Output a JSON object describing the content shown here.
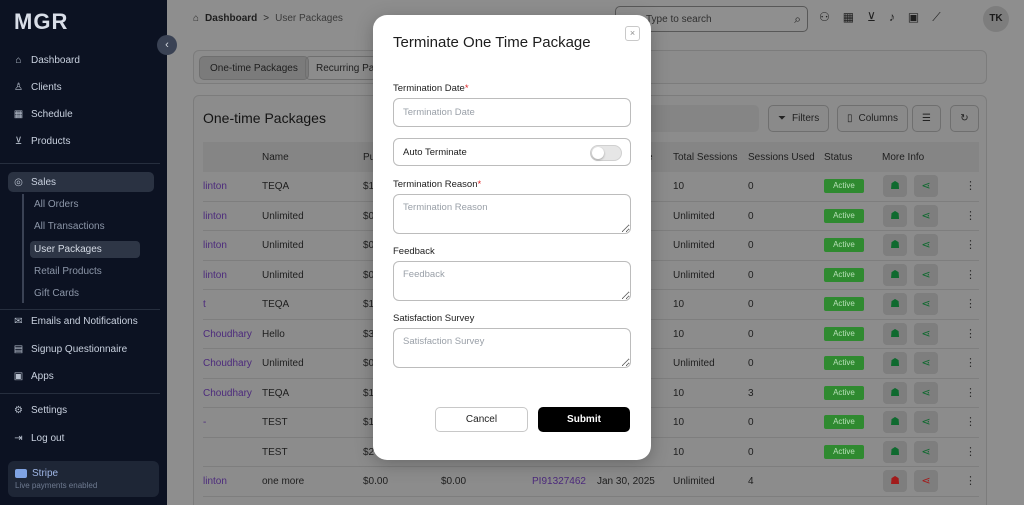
{
  "sidebar": {
    "logo": "MGR",
    "collapse_icon": "‹",
    "items": [
      {
        "label": "Dashboard",
        "icon": "home-icon"
      },
      {
        "label": "Clients",
        "icon": "user-icon"
      },
      {
        "label": "Schedule",
        "icon": "calendar-icon"
      },
      {
        "label": "Products",
        "icon": "cart-icon"
      },
      {
        "label": "Sales",
        "icon": "coins-icon"
      },
      {
        "label": "Emails and Notifications",
        "icon": "mail-icon"
      },
      {
        "label": "Signup Questionnaire",
        "icon": "questionnaire-icon"
      },
      {
        "label": "Apps",
        "icon": "apps-icon"
      },
      {
        "label": "Settings",
        "icon": "gear-icon"
      },
      {
        "label": "Log out",
        "icon": "logout-icon"
      }
    ],
    "sales_sub": [
      "All Orders",
      "All Transactions",
      "User Packages",
      "Retail Products",
      "Gift Cards"
    ],
    "stripe": {
      "title": "Stripe",
      "subtitle": "Live payments enabled"
    }
  },
  "topbar": {
    "breadcrumb_home": "Dashboard",
    "breadcrumb_sep": ">",
    "breadcrumb_current": "User Packages",
    "search_placeholder": "Type to search",
    "avatar_initials": "TK"
  },
  "tabs": [
    "One-time Packages",
    "Recurring Packages"
  ],
  "card": {
    "title": "One-time Packages",
    "filters_label": "Filters",
    "columns_label": "Columns"
  },
  "table": {
    "headers": [
      "Name",
      "Pu",
      "e",
      "Total Sessions",
      "Sessions Used",
      "Status",
      "More Info"
    ],
    "rows": [
      {
        "client": "linton",
        "name": "TEQA",
        "price": "$1",
        "paid": "",
        "invoice": "",
        "date": "",
        "total": "10",
        "used": "0",
        "status": "Active"
      },
      {
        "client": "linton",
        "name": "Unlimited",
        "price": "$0",
        "paid": "",
        "invoice": "",
        "date": "",
        "total": "Unlimited",
        "used": "0",
        "status": "Active"
      },
      {
        "client": "linton",
        "name": "Unlimited",
        "price": "$0",
        "paid": "",
        "invoice": "",
        "date": "",
        "total": "Unlimited",
        "used": "0",
        "status": "Active"
      },
      {
        "client": "linton",
        "name": "Unlimited",
        "price": "$0",
        "paid": "",
        "invoice": "",
        "date": "",
        "total": "Unlimited",
        "used": "0",
        "status": "Active"
      },
      {
        "client": "t",
        "name": "TEQA",
        "price": "$1",
        "paid": "",
        "invoice": "",
        "date": "",
        "total": "10",
        "used": "0",
        "status": "Active"
      },
      {
        "client": "Choudhary",
        "name": "Hello",
        "price": "$3",
        "paid": "",
        "invoice": "",
        "date": "",
        "total": "10",
        "used": "0",
        "status": "Active"
      },
      {
        "client": "Choudhary",
        "name": "Unlimited",
        "price": "$0",
        "paid": "",
        "invoice": "",
        "date": "",
        "total": "Unlimited",
        "used": "0",
        "status": "Active"
      },
      {
        "client": "Choudhary",
        "name": "TEQA",
        "price": "$1",
        "paid": "",
        "invoice": "",
        "date": "",
        "total": "10",
        "used": "3",
        "status": "Active"
      },
      {
        "client": "-",
        "name": "TEST",
        "price": "$1",
        "paid": "",
        "invoice": "",
        "date": "",
        "total": "10",
        "used": "0",
        "status": "Active"
      },
      {
        "client": "",
        "name": "TEST",
        "price": "$2",
        "paid": "",
        "invoice": "",
        "date": "",
        "total": "10",
        "used": "0",
        "status": "Active"
      },
      {
        "client": "linton",
        "name": "one more",
        "price": "$0.00",
        "paid": "$0.00",
        "invoice": "PI91327462",
        "date": "Jan 30, 2025",
        "total": "Unlimited",
        "used": "4",
        "status": ""
      }
    ]
  },
  "modal": {
    "title": "Terminate One Time Package",
    "close_icon": "×",
    "termination_date_label": "Termination Date",
    "termination_date_placeholder": "Termination Date",
    "auto_terminate_label": "Auto Terminate",
    "auto_terminate_on": false,
    "termination_reason_label": "Termination Reason",
    "termination_reason_placeholder": "Termination Reason",
    "feedback_label": "Feedback",
    "feedback_placeholder": "Feedback",
    "survey_label": "Satisfaction Survey",
    "survey_placeholder": "Satisfaction Survey",
    "required_mark": "*",
    "cancel_label": "Cancel",
    "submit_label": "Submit"
  },
  "colors": {
    "sidebar_bg": "#0c1222",
    "overlay": "#8e8e8e",
    "active_badge": "#2f8a30",
    "submit_bg": "#000000",
    "required": "#e02424"
  }
}
